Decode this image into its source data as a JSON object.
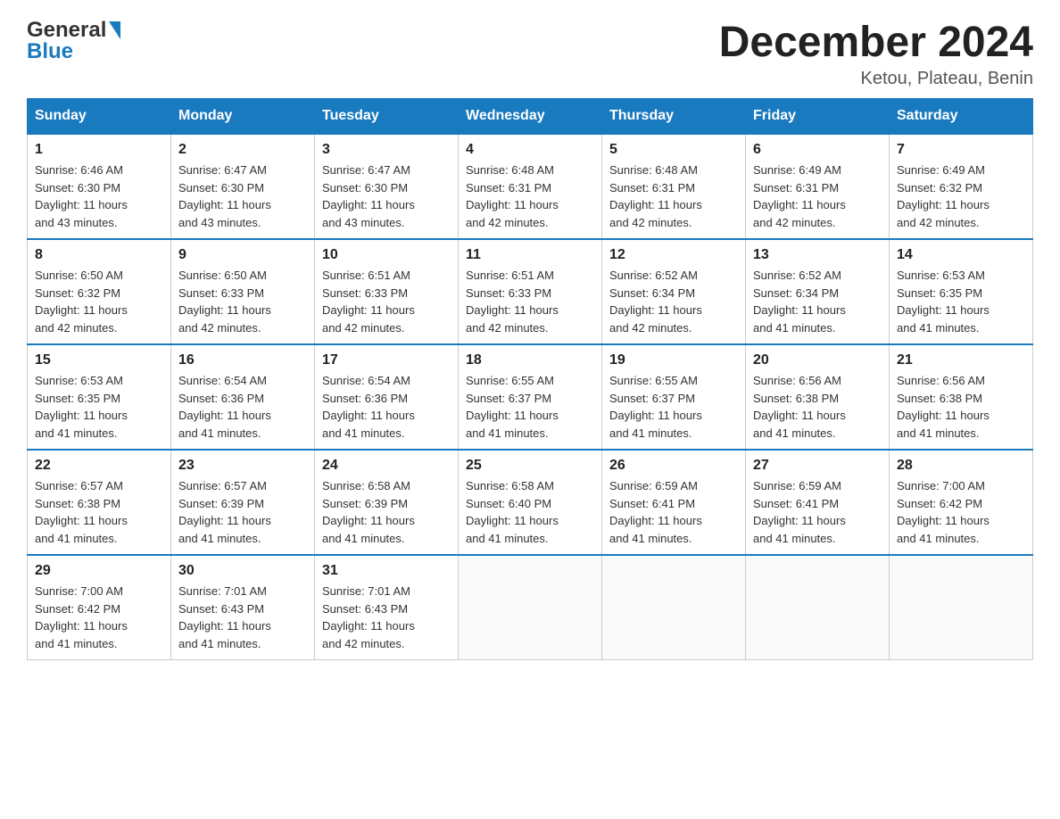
{
  "logo": {
    "line1": "General",
    "triangle": "▶",
    "line2": "Blue"
  },
  "title": "December 2024",
  "subtitle": "Ketou, Plateau, Benin",
  "days_of_week": [
    "Sunday",
    "Monday",
    "Tuesday",
    "Wednesday",
    "Thursday",
    "Friday",
    "Saturday"
  ],
  "weeks": [
    [
      {
        "day": "1",
        "sunrise": "6:46 AM",
        "sunset": "6:30 PM",
        "daylight": "11 hours and 43 minutes."
      },
      {
        "day": "2",
        "sunrise": "6:47 AM",
        "sunset": "6:30 PM",
        "daylight": "11 hours and 43 minutes."
      },
      {
        "day": "3",
        "sunrise": "6:47 AM",
        "sunset": "6:30 PM",
        "daylight": "11 hours and 43 minutes."
      },
      {
        "day": "4",
        "sunrise": "6:48 AM",
        "sunset": "6:31 PM",
        "daylight": "11 hours and 42 minutes."
      },
      {
        "day": "5",
        "sunrise": "6:48 AM",
        "sunset": "6:31 PM",
        "daylight": "11 hours and 42 minutes."
      },
      {
        "day": "6",
        "sunrise": "6:49 AM",
        "sunset": "6:31 PM",
        "daylight": "11 hours and 42 minutes."
      },
      {
        "day": "7",
        "sunrise": "6:49 AM",
        "sunset": "6:32 PM",
        "daylight": "11 hours and 42 minutes."
      }
    ],
    [
      {
        "day": "8",
        "sunrise": "6:50 AM",
        "sunset": "6:32 PM",
        "daylight": "11 hours and 42 minutes."
      },
      {
        "day": "9",
        "sunrise": "6:50 AM",
        "sunset": "6:33 PM",
        "daylight": "11 hours and 42 minutes."
      },
      {
        "day": "10",
        "sunrise": "6:51 AM",
        "sunset": "6:33 PM",
        "daylight": "11 hours and 42 minutes."
      },
      {
        "day": "11",
        "sunrise": "6:51 AM",
        "sunset": "6:33 PM",
        "daylight": "11 hours and 42 minutes."
      },
      {
        "day": "12",
        "sunrise": "6:52 AM",
        "sunset": "6:34 PM",
        "daylight": "11 hours and 42 minutes."
      },
      {
        "day": "13",
        "sunrise": "6:52 AM",
        "sunset": "6:34 PM",
        "daylight": "11 hours and 41 minutes."
      },
      {
        "day": "14",
        "sunrise": "6:53 AM",
        "sunset": "6:35 PM",
        "daylight": "11 hours and 41 minutes."
      }
    ],
    [
      {
        "day": "15",
        "sunrise": "6:53 AM",
        "sunset": "6:35 PM",
        "daylight": "11 hours and 41 minutes."
      },
      {
        "day": "16",
        "sunrise": "6:54 AM",
        "sunset": "6:36 PM",
        "daylight": "11 hours and 41 minutes."
      },
      {
        "day": "17",
        "sunrise": "6:54 AM",
        "sunset": "6:36 PM",
        "daylight": "11 hours and 41 minutes."
      },
      {
        "day": "18",
        "sunrise": "6:55 AM",
        "sunset": "6:37 PM",
        "daylight": "11 hours and 41 minutes."
      },
      {
        "day": "19",
        "sunrise": "6:55 AM",
        "sunset": "6:37 PM",
        "daylight": "11 hours and 41 minutes."
      },
      {
        "day": "20",
        "sunrise": "6:56 AM",
        "sunset": "6:38 PM",
        "daylight": "11 hours and 41 minutes."
      },
      {
        "day": "21",
        "sunrise": "6:56 AM",
        "sunset": "6:38 PM",
        "daylight": "11 hours and 41 minutes."
      }
    ],
    [
      {
        "day": "22",
        "sunrise": "6:57 AM",
        "sunset": "6:38 PM",
        "daylight": "11 hours and 41 minutes."
      },
      {
        "day": "23",
        "sunrise": "6:57 AM",
        "sunset": "6:39 PM",
        "daylight": "11 hours and 41 minutes."
      },
      {
        "day": "24",
        "sunrise": "6:58 AM",
        "sunset": "6:39 PM",
        "daylight": "11 hours and 41 minutes."
      },
      {
        "day": "25",
        "sunrise": "6:58 AM",
        "sunset": "6:40 PM",
        "daylight": "11 hours and 41 minutes."
      },
      {
        "day": "26",
        "sunrise": "6:59 AM",
        "sunset": "6:41 PM",
        "daylight": "11 hours and 41 minutes."
      },
      {
        "day": "27",
        "sunrise": "6:59 AM",
        "sunset": "6:41 PM",
        "daylight": "11 hours and 41 minutes."
      },
      {
        "day": "28",
        "sunrise": "7:00 AM",
        "sunset": "6:42 PM",
        "daylight": "11 hours and 41 minutes."
      }
    ],
    [
      {
        "day": "29",
        "sunrise": "7:00 AM",
        "sunset": "6:42 PM",
        "daylight": "11 hours and 41 minutes."
      },
      {
        "day": "30",
        "sunrise": "7:01 AM",
        "sunset": "6:43 PM",
        "daylight": "11 hours and 41 minutes."
      },
      {
        "day": "31",
        "sunrise": "7:01 AM",
        "sunset": "6:43 PM",
        "daylight": "11 hours and 42 minutes."
      },
      null,
      null,
      null,
      null
    ]
  ],
  "labels": {
    "sunrise": "Sunrise:",
    "sunset": "Sunset:",
    "daylight": "Daylight:"
  }
}
